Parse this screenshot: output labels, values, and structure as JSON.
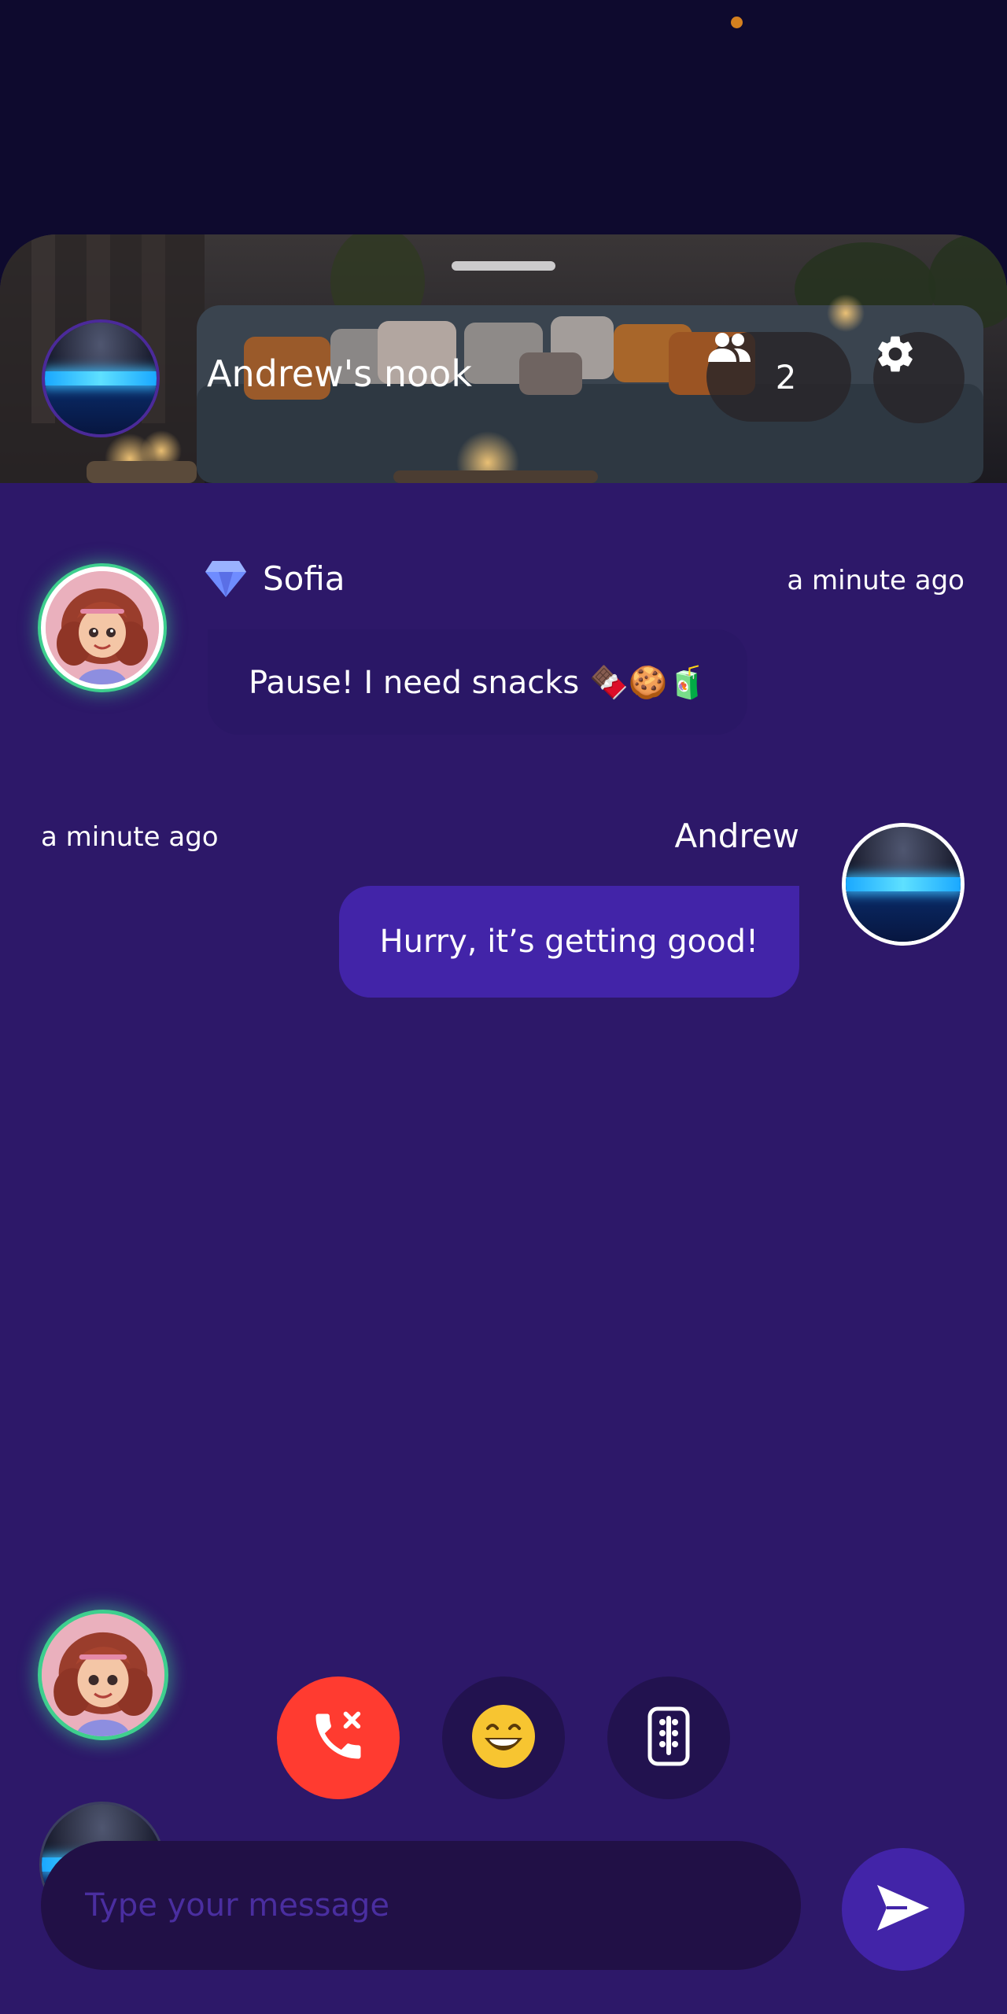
{
  "room": {
    "title": "Andrew's nook",
    "member_count": "2"
  },
  "messages": [
    {
      "sender": "Sofia",
      "time": "a minute ago",
      "text": "Pause! I need snacks 🍫🍪🧃",
      "direction": "incoming"
    },
    {
      "sender": "Andrew",
      "time": "a minute ago",
      "text": "Hurry, it’s getting good!",
      "direction": "outgoing"
    }
  ],
  "composer": {
    "placeholder": "Type your message"
  },
  "icons": {
    "members": "people-icon",
    "settings": "gear-icon",
    "sender_badge": "diamond-icon",
    "hangup": "phone-hangup-icon",
    "emoji": "smiley-icon",
    "remote": "remote-control-icon",
    "send": "send-icon"
  },
  "colors": {
    "background": "#2d1869",
    "accent": "#4224a8",
    "hangup": "#ff3b30",
    "online_ring": "#3ecf8e"
  }
}
